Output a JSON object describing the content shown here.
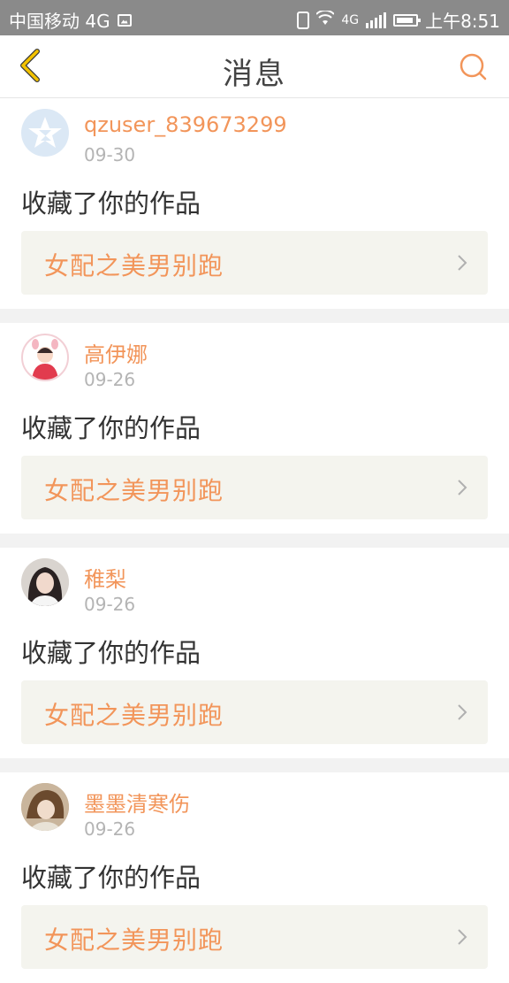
{
  "status_bar": {
    "carrier": "中国移动 4G",
    "network": "4G",
    "time": "上午8:51"
  },
  "nav": {
    "title": "消息",
    "back_icon": "chevron-left-icon",
    "search_icon": "search-icon"
  },
  "colors": {
    "accent": "#f2955a",
    "back": "#f3c200",
    "card_bg": "#f4f4ee",
    "separator": "#f2f2f2"
  },
  "messages": [
    {
      "username": "qzuser_839673299",
      "date": "09-30",
      "action": "收藏了你的作品",
      "work_title": "女配之美男别跑"
    },
    {
      "username": "高伊娜",
      "date": "09-26",
      "action": "收藏了你的作品",
      "work_title": "女配之美男别跑"
    },
    {
      "username": "稚梨",
      "date": "09-26",
      "action": "收藏了你的作品",
      "work_title": "女配之美男别跑"
    },
    {
      "username": "墨墨清寒伤",
      "date": "09-26",
      "action": "收藏了你的作品",
      "work_title": "女配之美男别跑"
    }
  ]
}
